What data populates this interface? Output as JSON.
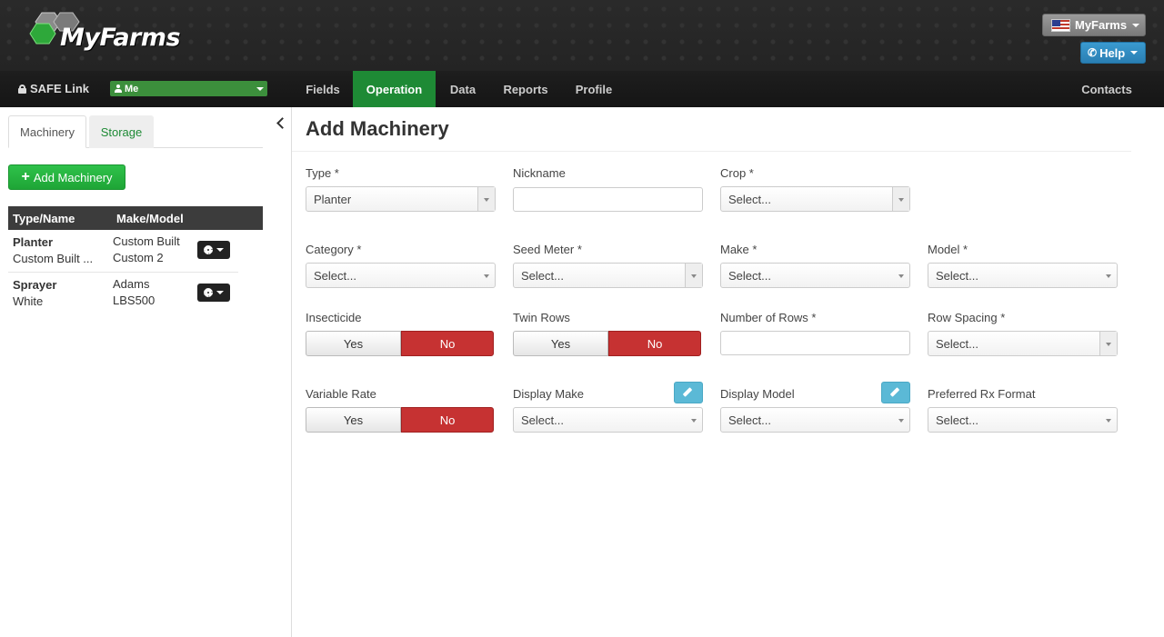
{
  "header": {
    "logo_text": "MyFarms",
    "account_label": "MyFarms",
    "help_label": "Help",
    "colors": {
      "brand_green": "#1e8a35",
      "help_blue": "#2a7fb3",
      "danger_red": "#c63232"
    }
  },
  "navbar": {
    "safe_link": "SAFE Link",
    "user_select": "Me",
    "items": [
      "Fields",
      "Operation",
      "Data",
      "Reports",
      "Profile"
    ],
    "active": "Operation",
    "contacts": "Contacts"
  },
  "sidebar": {
    "tabs": [
      "Machinery",
      "Storage"
    ],
    "add_button": "Add Machinery",
    "table_headers": [
      "Type/Name",
      "Make/Model"
    ],
    "rows": [
      {
        "type": "Planter",
        "name": "Custom Built ...",
        "make": "Custom Built",
        "model": "Custom 2"
      },
      {
        "type": "Sprayer",
        "name": "White",
        "make": "Adams",
        "model": "LBS500"
      }
    ]
  },
  "main": {
    "title": "Add Machinery",
    "fields": {
      "type": {
        "label": "Type *",
        "value": "Planter"
      },
      "nickname": {
        "label": "Nickname",
        "value": ""
      },
      "crop": {
        "label": "Crop *",
        "value": "Select..."
      },
      "category": {
        "label": "Category *",
        "value": "Select..."
      },
      "seed_meter": {
        "label": "Seed Meter *",
        "value": "Select..."
      },
      "make": {
        "label": "Make *",
        "value": "Select..."
      },
      "model": {
        "label": "Model *",
        "value": "Select..."
      },
      "insecticide": {
        "label": "Insecticide",
        "yes": "Yes",
        "no": "No"
      },
      "twin_rows": {
        "label": "Twin Rows",
        "yes": "Yes",
        "no": "No"
      },
      "number_of_rows": {
        "label": "Number of Rows *",
        "value": ""
      },
      "row_spacing": {
        "label": "Row Spacing *",
        "value": "Select..."
      },
      "variable_rate": {
        "label": "Variable Rate",
        "yes": "Yes",
        "no": "No"
      },
      "display_make": {
        "label": "Display Make",
        "value": "Select..."
      },
      "display_model": {
        "label": "Display Model",
        "value": "Select..."
      },
      "preferred_rx_format": {
        "label": "Preferred Rx Format",
        "value": "Select..."
      }
    }
  }
}
